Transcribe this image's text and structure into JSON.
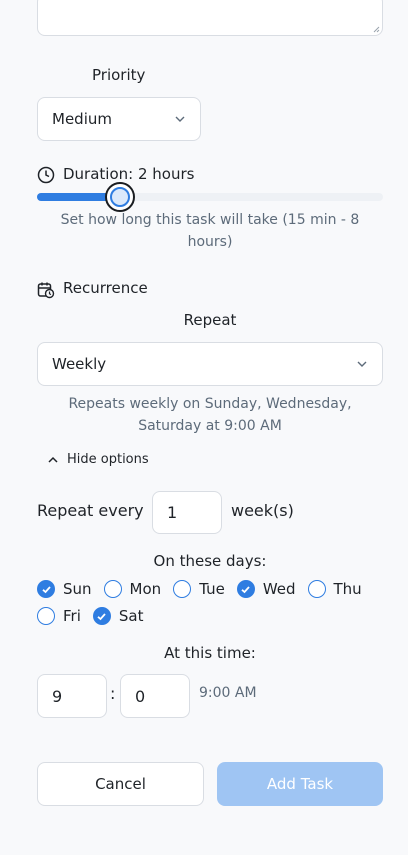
{
  "priority": {
    "label": "Priority",
    "value": "Medium"
  },
  "duration": {
    "label": "Duration: 2 hours",
    "fraction": 0.24,
    "hint": "Set how long this task will take (15 min - 8 hours)"
  },
  "recurrence": {
    "heading": "Recurrence",
    "repeat_label": "Repeat",
    "repeat_value": "Weekly",
    "summary": "Repeats weekly on Sunday, Wednesday, Saturday at 9:00 AM",
    "toggle_label": "Hide options",
    "repeat_every_label": "Repeat every",
    "repeat_every_value": "1",
    "repeat_every_unit": "week(s)",
    "days_label": "On these days:",
    "days": [
      {
        "label": "Sun",
        "checked": true
      },
      {
        "label": "Mon",
        "checked": false
      },
      {
        "label": "Tue",
        "checked": false
      },
      {
        "label": "Wed",
        "checked": true
      },
      {
        "label": "Thu",
        "checked": false
      },
      {
        "label": "Fri",
        "checked": false
      },
      {
        "label": "Sat",
        "checked": true
      }
    ],
    "time_label": "At this time:",
    "hour": "9",
    "minute": "0",
    "separator": ":",
    "time_display": "9:00 AM"
  },
  "actions": {
    "cancel": "Cancel",
    "add": "Add Task"
  },
  "colors": {
    "accent": "#2f7de1",
    "add_button_disabled": "#9fc5f3"
  }
}
